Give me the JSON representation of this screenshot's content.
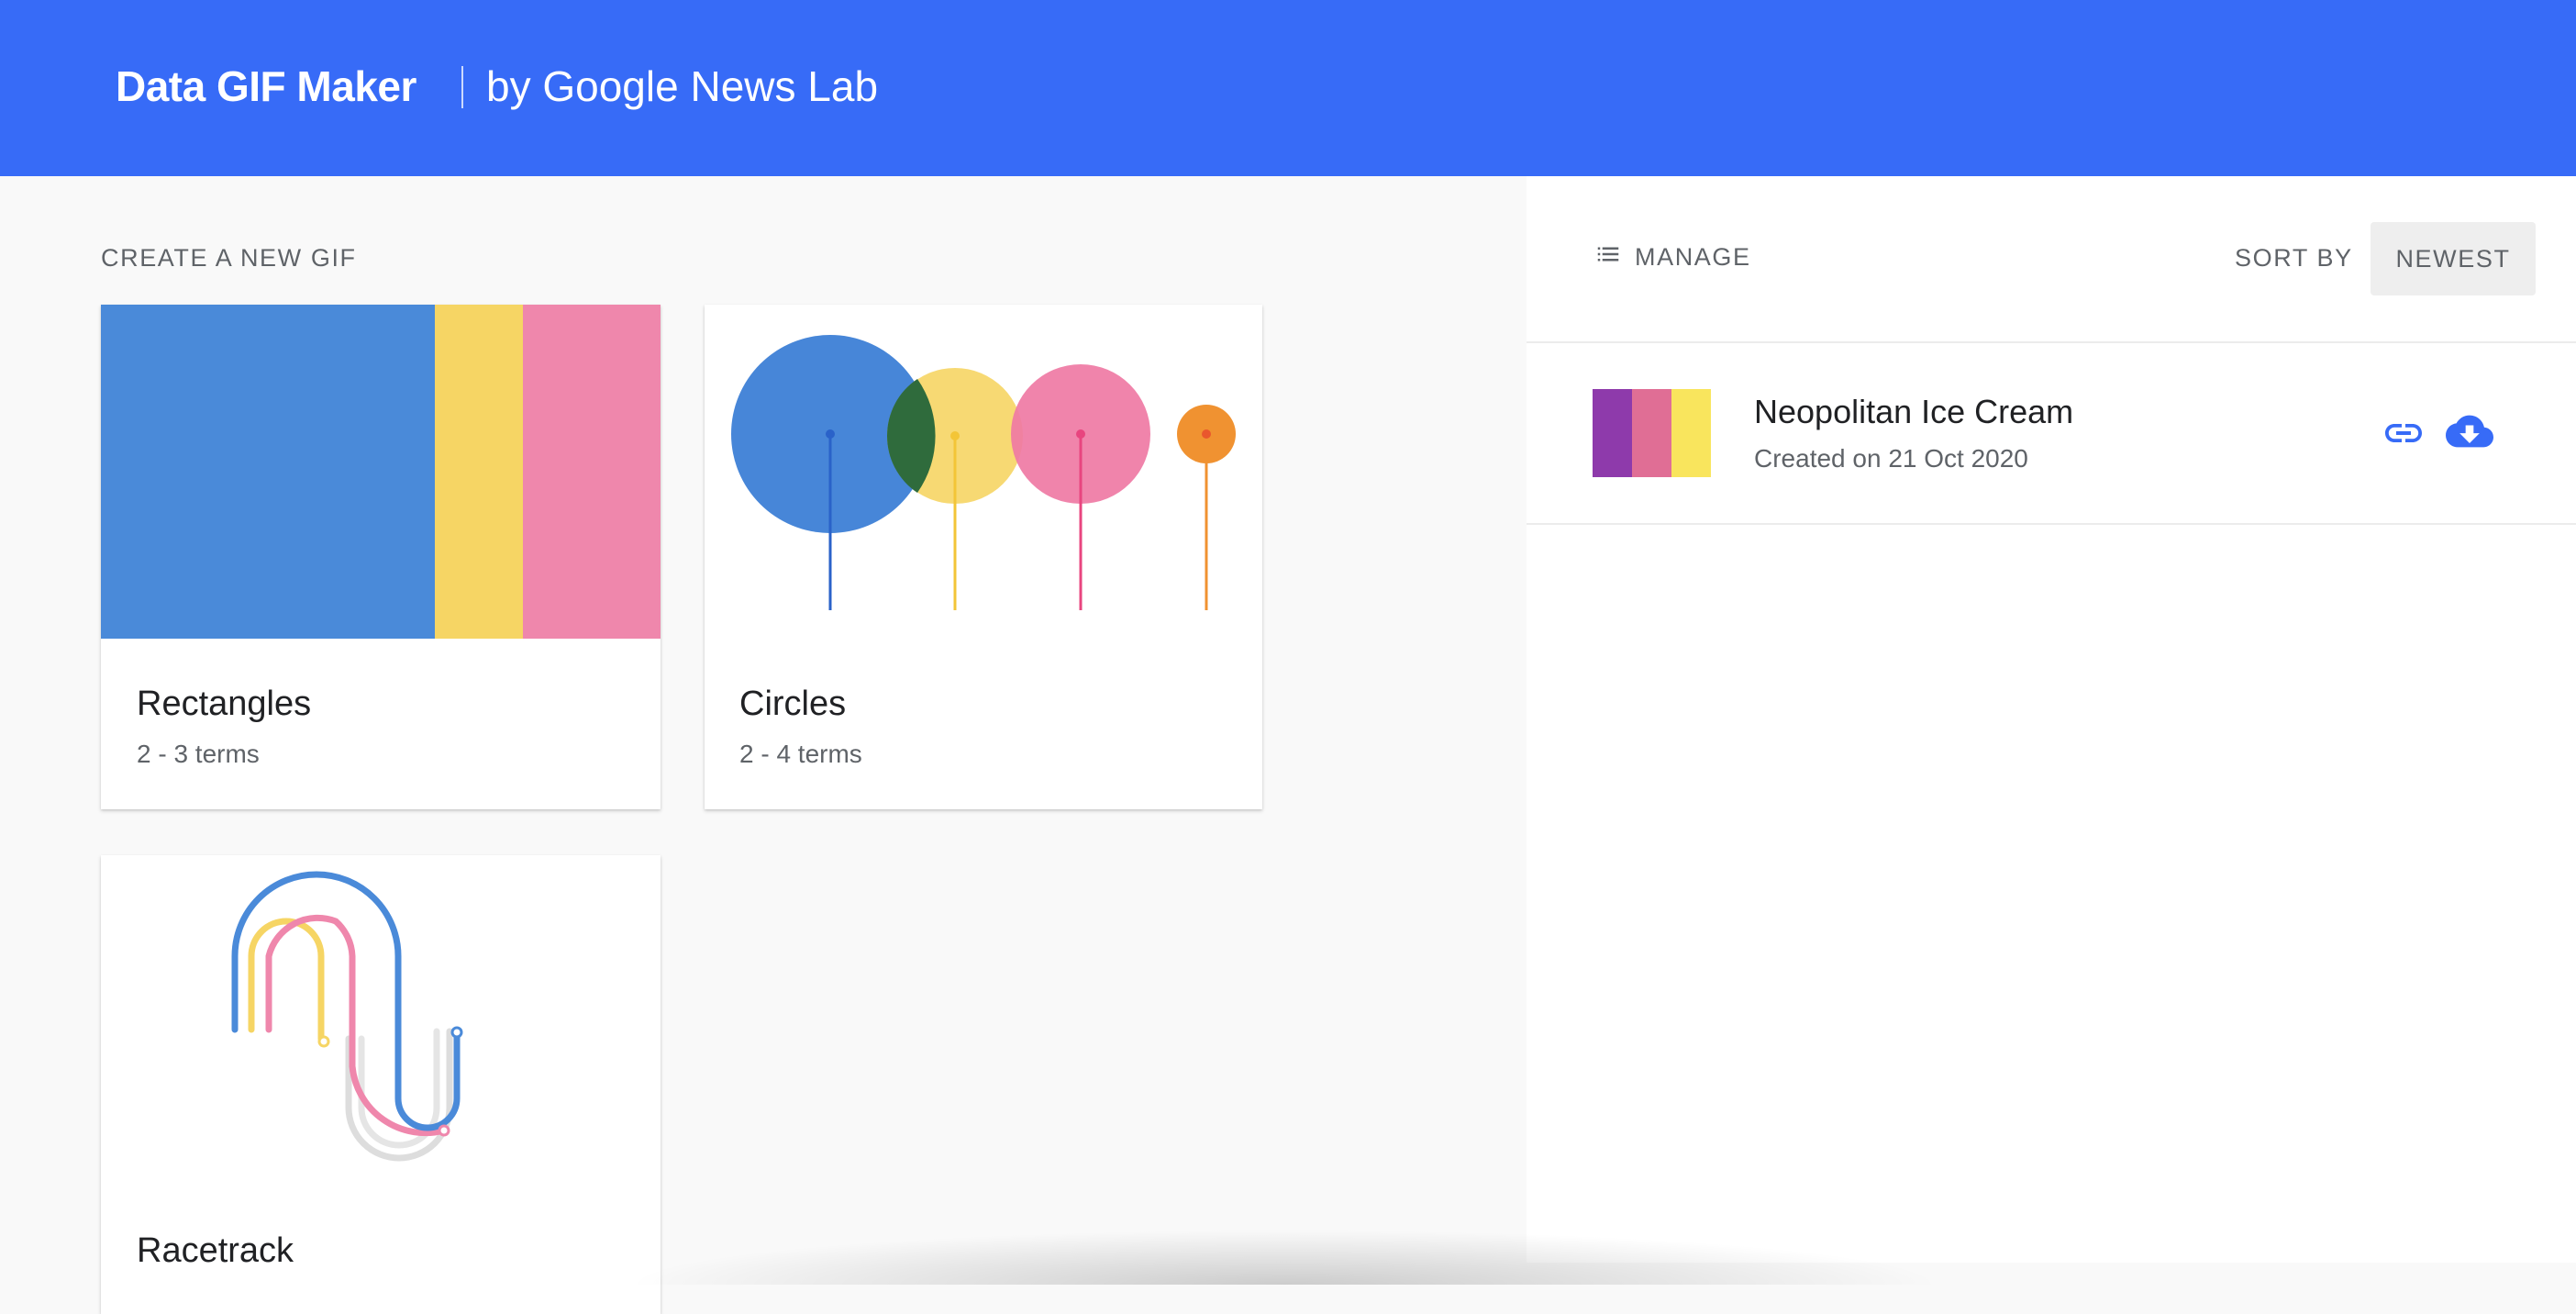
{
  "header": {
    "brand": "Data GIF Maker",
    "subtitle": "by Google News Lab",
    "background": "#376bf7"
  },
  "create_section": {
    "title": "CREATE A NEW GIF",
    "templates": [
      {
        "name": "Rectangles",
        "terms": "2 - 3 terms",
        "colors": [
          "#4a8ad9",
          "#f6d564",
          "#ef87ac"
        ]
      },
      {
        "name": "Circles",
        "terms": "2 - 4 terms",
        "colors": [
          "#3d7fd6",
          "#f6d564",
          "#ef79a4",
          "#f09231"
        ]
      },
      {
        "name": "Racetrack",
        "terms": "",
        "colors": [
          "#4a8ad9",
          "#ef87ac",
          "#f6d564",
          "#dddddd"
        ]
      }
    ]
  },
  "manage_section": {
    "label": "MANAGE",
    "icon": "list-icon",
    "sort_label": "SORT BY",
    "sort_value": "NEWEST"
  },
  "gifs": [
    {
      "title": "Neopolitan Ice Cream",
      "created": "Created on 21 Oct 2020",
      "colors": [
        "#8e3aab",
        "#e06e95",
        "#f9e55d"
      ],
      "actions": [
        "link-icon",
        "cloud-download-icon"
      ]
    }
  ],
  "colors": {
    "accent": "#376bf7"
  }
}
